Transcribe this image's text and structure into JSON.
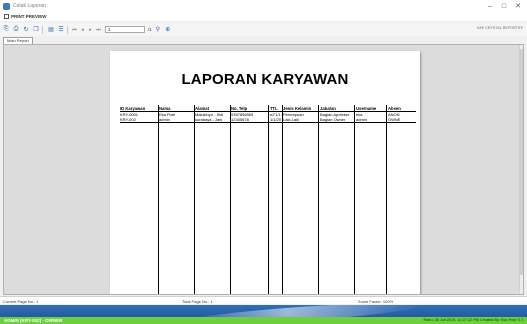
{
  "window": {
    "title": "Cetak Laporan",
    "minimize": "–",
    "maximize": "□",
    "close": "✕"
  },
  "header": {
    "label": "PRINT PREVIEW"
  },
  "toolbar": {
    "page_value": "1",
    "page_of": "/1",
    "brand": "SAP CRYSTAL REPORTS®"
  },
  "tab": {
    "label": "Main Report"
  },
  "report": {
    "title": "LAPORAN KARYAWAN",
    "columns": [
      "ID Karyawan",
      "Nama",
      "Alamat",
      "No. Telp",
      "TTL",
      "Jenis Kelamin",
      "Jabatan",
      "Username",
      "Absen"
    ],
    "rows": [
      [
        "KRY-0001",
        "Eka Putri",
        "Malukinyo - Sidi",
        "0357896569",
        "e2'1/1",
        "Perempuan",
        "Bagian Apoteker",
        "eka",
        "ANON"
      ],
      [
        "KRY-002",
        "admin",
        "surabaya - Jaw",
        "12345678",
        "1/1/20",
        "Laki-Laki",
        "Bagian Owner",
        "admin",
        "OWNE"
      ]
    ]
  },
  "status": {
    "current_page": "Current Page No.: 1",
    "total_page": "Total Page No.: 1",
    "zoom": "Zoom Factor: 100%"
  },
  "banner": {
    "user": "ADMIN (KRY-002) - OWNER",
    "clock": "Rabu, 30 Juli 2019, 10:27:22 PM Created By: Eka Putri S.T."
  }
}
